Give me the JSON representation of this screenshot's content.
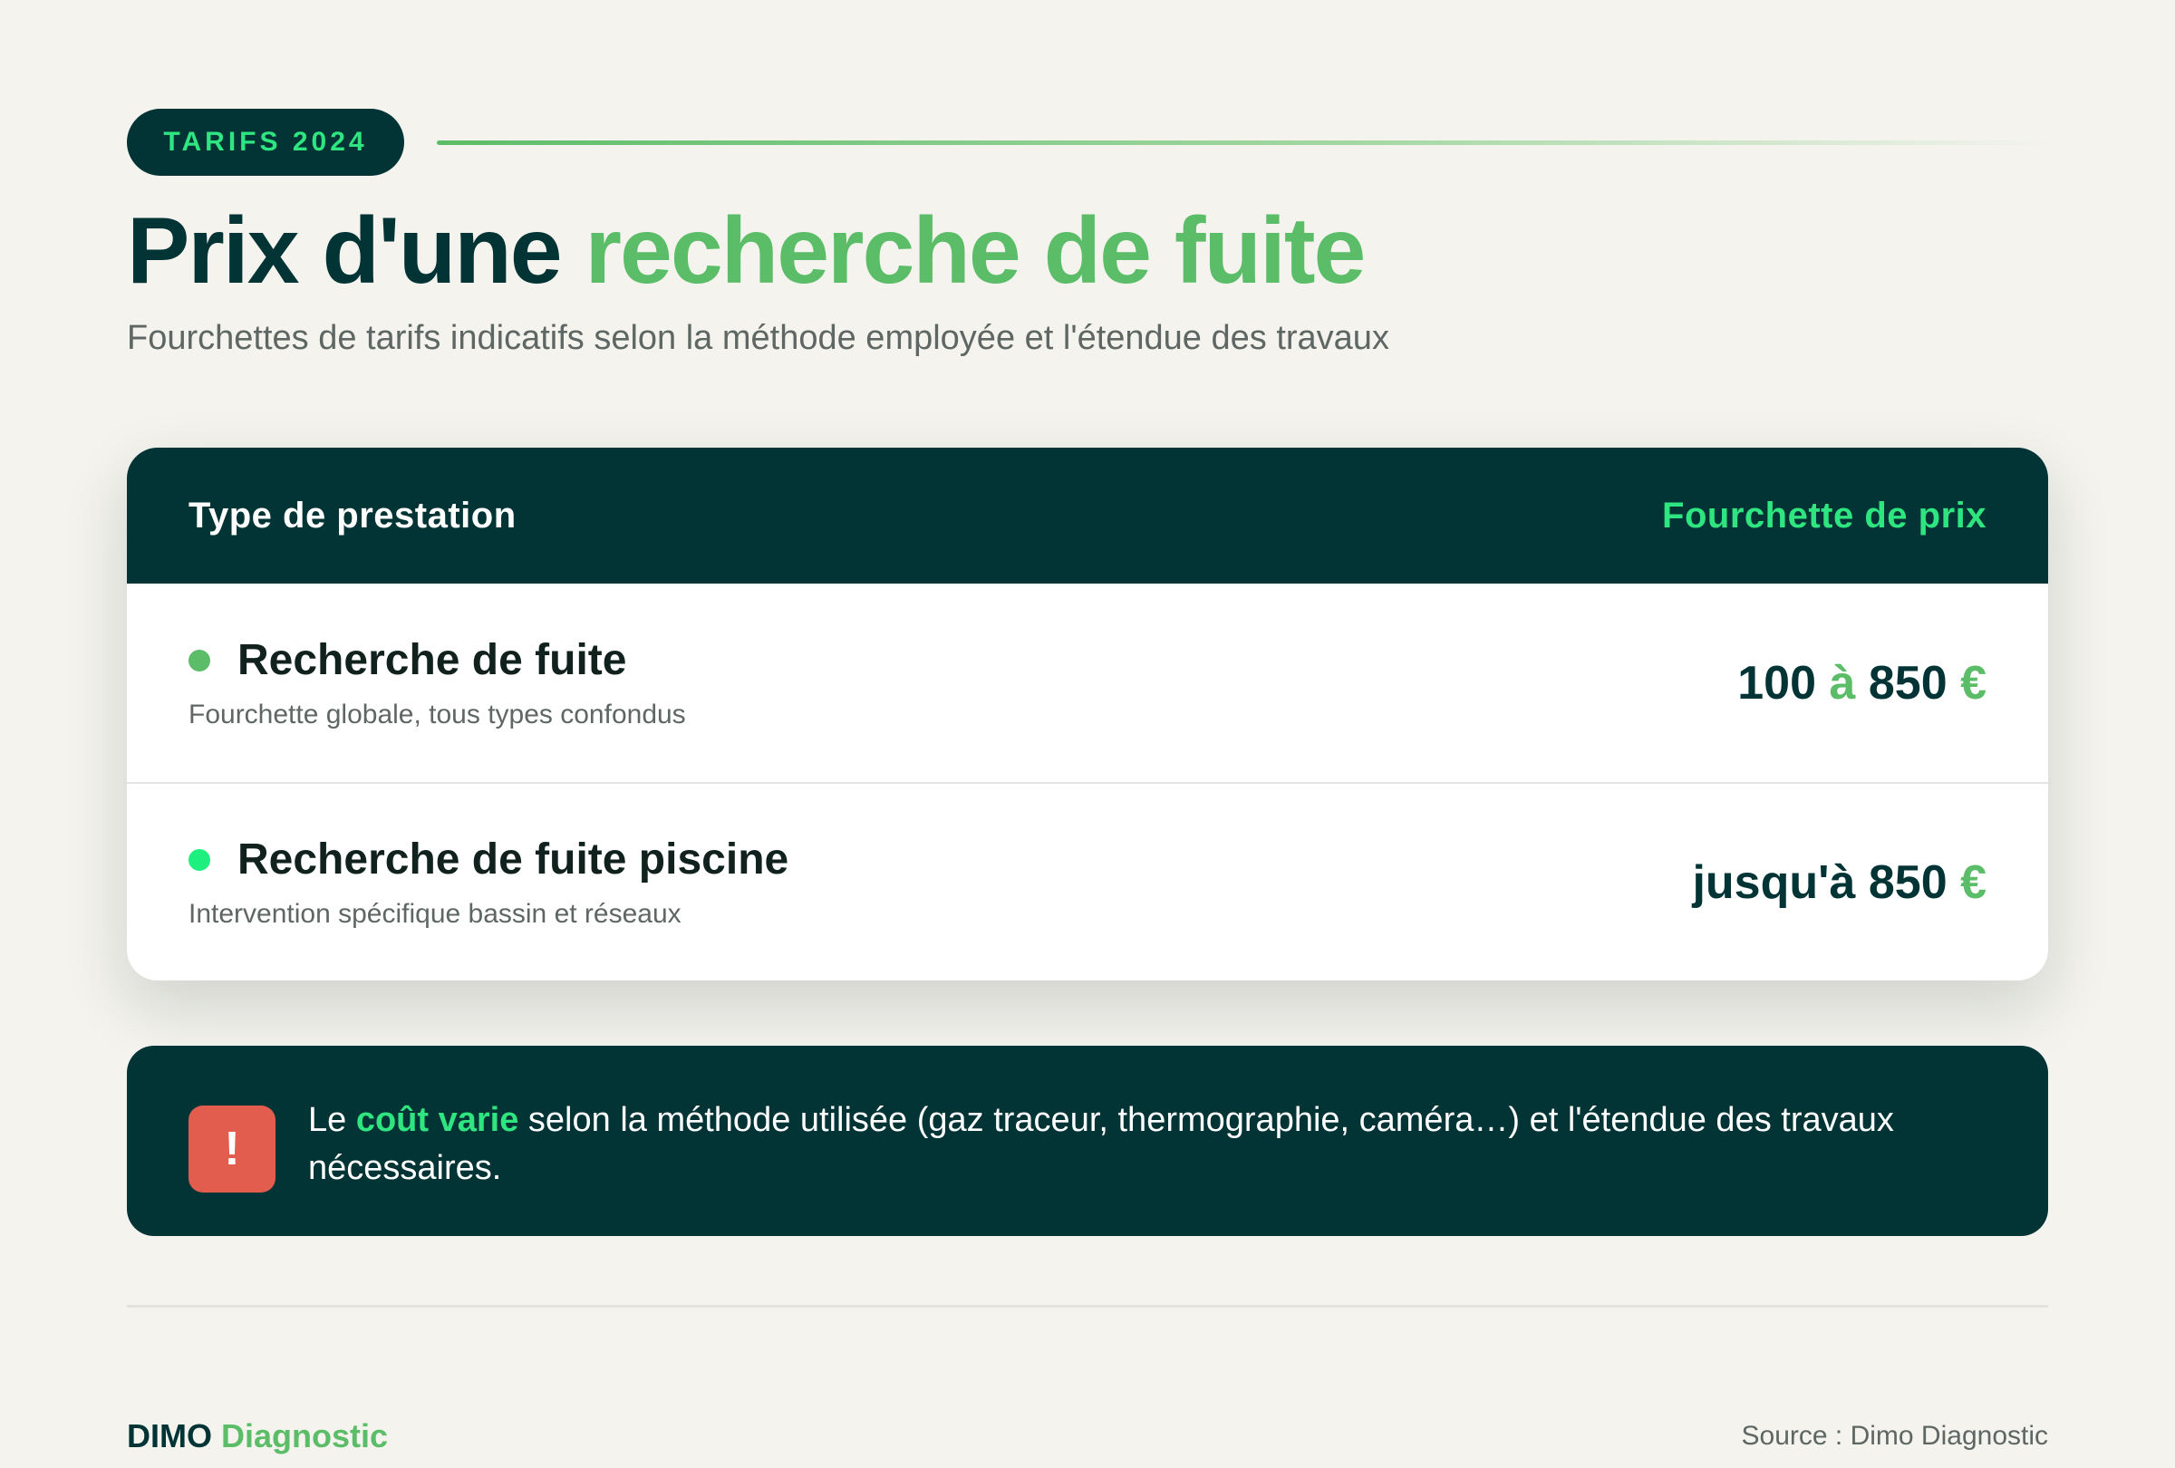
{
  "header": {
    "badge": "TARIFS 2024",
    "title_main": "Prix d'une ",
    "title_accent": "recherche de fuite",
    "subtitle": "Fourchettes de tarifs indicatifs selon la méthode employée et l'étendue des travaux"
  },
  "table": {
    "col_type": "Type de prestation",
    "col_price": "Fourchette de prix",
    "rows": [
      {
        "title": "Recherche de fuite",
        "subtitle": "Fourchette globale, tous types confondus",
        "price_from": "100",
        "price_sep": "à",
        "price_to": "850",
        "currency": "€",
        "dot_color": "#5cbd68"
      },
      {
        "title": "Recherche de fuite piscine",
        "subtitle": "Intervention spécifique bassin et réseaux",
        "price_prefix": "jusqu'à 850",
        "currency": "€",
        "dot_color": "#1ef07f"
      }
    ]
  },
  "note": {
    "icon": "exclamation-icon",
    "icon_glyph": "!",
    "text_before": "Le ",
    "text_highlight": "coût varie",
    "text_after": " selon la méthode utilisée (gaz traceur, thermographie, caméra…) et l'étendue des travaux nécessaires."
  },
  "footer": {
    "brand_main": "DIMO",
    "brand_accent": "Diagnostic",
    "source": "Source : Dimo Diagnostic"
  },
  "colors": {
    "dark": "#023436",
    "green": "#5cbd68",
    "bright_green": "#2ee57f",
    "alert": "#e35d4f",
    "background": "#f4f3ee"
  }
}
